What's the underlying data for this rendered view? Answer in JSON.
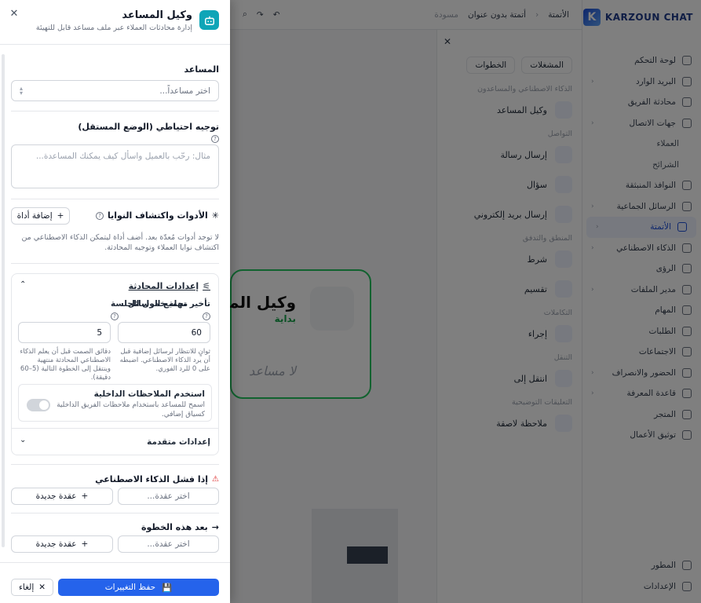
{
  "background": {
    "brand": "KARZOUN CHAT",
    "topbar": {
      "crumb_root": "الأتمتة",
      "title": "أتمتة بدون عنوان",
      "status": "مسودة"
    },
    "nav": [
      {
        "label": "لوحة التحكم",
        "sub": false,
        "active": false
      },
      {
        "label": "البريد الوارد",
        "sub": false,
        "active": false,
        "chev": true
      },
      {
        "label": "محادثة الفريق",
        "sub": false,
        "active": false
      },
      {
        "label": "جهات الاتصال",
        "sub": false,
        "active": false,
        "chev": true
      },
      {
        "label": "العملاء",
        "sub": true,
        "active": false
      },
      {
        "label": "الشرائح",
        "sub": true,
        "active": false
      },
      {
        "label": "النوافذ المنبثقة",
        "sub": false,
        "active": false
      },
      {
        "label": "الرسائل الجماعية",
        "sub": false,
        "active": false,
        "chev": true
      },
      {
        "label": "الأتمتة",
        "sub": false,
        "active": true,
        "chev": true
      },
      {
        "label": "الذكاء الاصطناعي",
        "sub": false,
        "active": false,
        "chev": true
      },
      {
        "label": "الرؤى",
        "sub": false,
        "active": false
      },
      {
        "label": "مدير الملفات",
        "sub": false,
        "active": false,
        "chev": true
      },
      {
        "label": "المهام",
        "sub": false,
        "active": false
      },
      {
        "label": "الطلبات",
        "sub": false,
        "active": false
      },
      {
        "label": "الاجتماعات",
        "sub": false,
        "active": false
      },
      {
        "label": "الحضور والانصراف",
        "sub": false,
        "active": false,
        "chev": true
      },
      {
        "label": "قاعدة المعرفة",
        "sub": false,
        "active": false,
        "chev": true
      },
      {
        "label": "المتجر",
        "sub": false,
        "active": false
      },
      {
        "label": "توثيق الأعمال",
        "sub": false,
        "active": false
      }
    ],
    "nav_bottom": [
      "المطور",
      "الإعدادات"
    ],
    "panel": {
      "tab_steps": "الخطوات",
      "tab_trigger": "المشغلات",
      "groups": [
        {
          "title": "الذكاء الاصطناعي والمساعدون",
          "items": [
            "وكيل المساعد"
          ]
        },
        {
          "title": "التواصل",
          "items": [
            "إرسال رسالة",
            "سؤال",
            "إرسال بريد إلكتروني"
          ]
        },
        {
          "title": "المنطق والتدفق",
          "items": [
            "شرط",
            "تقسيم"
          ]
        },
        {
          "title": "التكاملات",
          "items": [
            "إجراء"
          ]
        },
        {
          "title": "التنقل",
          "items": [
            "انتقل إلى"
          ]
        },
        {
          "title": "التعليقات التوضيحية",
          "items": [
            "ملاحظة لاصقة"
          ]
        }
      ]
    },
    "node": {
      "title": "وكيل المساعد",
      "subtitle": "بداية",
      "placeholder": "لا مساعد"
    }
  },
  "drawer": {
    "title": "وكيل المساعد",
    "subtitle": "إدارة محادثات العملاء عبر ملف مساعد قابل للتهيئة",
    "assistant_label": "المساعد",
    "assistant_placeholder": "اختر مساعداً...",
    "fallback_label": "توجيه احتياطي (الوضع المستقل)",
    "fallback_placeholder": "مثال: رحّب بالعميل واسأل كيف يمكنك المساعدة...",
    "tools_label": "الأدوات واكتشاف النوايا",
    "add_tool": "إضافة أداة",
    "tools_empty": "لا توجد أدوات مُعدّة بعد. أضف أداة ليتمكن الذكاء الاصطناعي من اكتشاف نوايا العملاء وتوجيه المحادثة.",
    "conv_settings": "إعدادات المحادثة",
    "delay_label": "تأخير تجميع الرسائل",
    "delay_value": "60",
    "delay_help": "ثوانٍ للانتظار لرسائل إضافية قبل أن يرد الذكاء الاصطناعي. اضبطه على 0 للرد الفوري.",
    "timeout_label": "مهلة خمول الجلسة",
    "timeout_value": "5",
    "timeout_help": "دقائق الصمت قبل أن يعلم الذكاء الاصطناعي المحادثة منتهية وينتقل إلى الخطوة التالية (5–60 دقيقة).",
    "notes_title": "استخدم الملاحظات الداخلية",
    "notes_desc": "اسمح للمساعد باستخدام ملاحظات الفريق الداخلية كسياق إضافي.",
    "advanced": "إعدادات متقدمة",
    "fail_label": "إذا فشل الذكاء الاصطناعي",
    "choose_node": "اختر عقدة...",
    "new_node": "عقدة جديدة",
    "next_label": "بعد هذه الخطوة",
    "save": "حفظ التغييرات",
    "cancel": "إلغاء"
  },
  "colors": {
    "primary": "#2563eb",
    "accent_icon": "#0ea5b7",
    "node_border": "#22c55e",
    "warning": "#dc2626"
  }
}
